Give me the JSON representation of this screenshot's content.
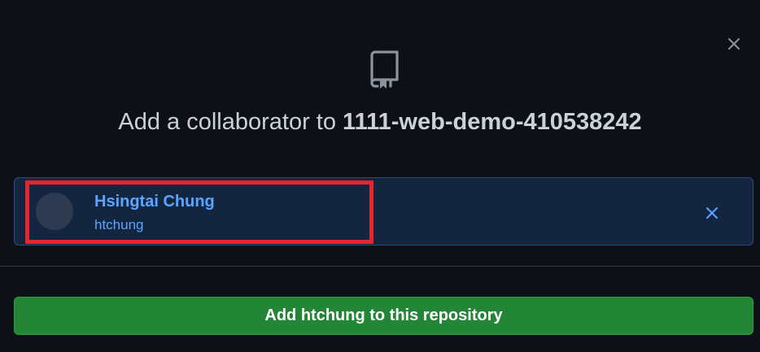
{
  "dialog": {
    "close_icon": "close-icon",
    "repo_icon": "repo-icon",
    "title_prefix": "Add a collaborator to",
    "repo_name": "1111-web-demo-410538242"
  },
  "selected_user": {
    "name": "Hsingtai Chung",
    "login": "htchung",
    "remove_icon": "close-icon"
  },
  "action": {
    "add_button_label": "Add htchung to this repository"
  },
  "colors": {
    "background": "#0d1117",
    "link": "#58a6ff",
    "button": "#238636",
    "highlight": "#e5262e"
  }
}
